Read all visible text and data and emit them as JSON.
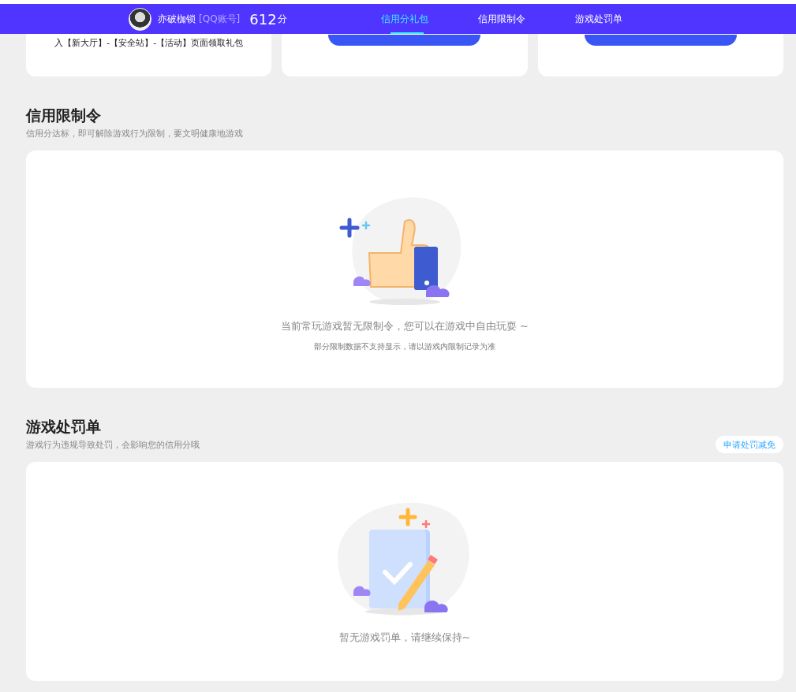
{
  "header": {
    "username": "亦破枷锁",
    "account_type": "[QQ账号]",
    "score": "612",
    "score_unit": "分",
    "tabs": [
      {
        "label": "信用分礼包",
        "selected": true
      },
      {
        "label": "信用限制令",
        "selected": false
      },
      {
        "label": "游戏处罚单",
        "selected": false
      }
    ]
  },
  "gift_cards": [
    {
      "kind": "text",
      "text": "入【新大厅】-【安全站】-【活动】页面领取礼包"
    },
    {
      "kind": "button"
    },
    {
      "kind": "button"
    }
  ],
  "restriction": {
    "title": "信用限制令",
    "subtitle": "信用分达标，即可解除游戏行为限制，要文明健康地游戏",
    "empty_message": "当前常玩游戏暂无限制令，您可以在游戏中自由玩耍 ~",
    "note": "部分限制数据不支持显示，请以游戏内限制记录为准"
  },
  "penalty": {
    "title": "游戏处罚单",
    "subtitle": "游戏行为违规导致处罚，会影响您的信用分哦",
    "action": "申请处罚减免",
    "empty_message": "暂无游戏罚单，请继续保持~"
  }
}
